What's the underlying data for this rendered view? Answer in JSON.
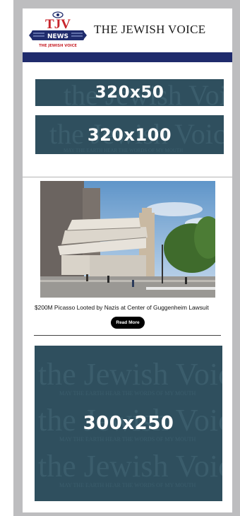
{
  "header": {
    "logo_main": "TJV",
    "logo_news": "NEWS",
    "logo_sub": "THE JEWISH VOICE",
    "title": "THE JEWISH VOICE"
  },
  "ads": {
    "leaderboard_small": "320x50",
    "leaderboard_large": "320x100",
    "medium_rectangle": "300x250",
    "watermark_name": "the Jewish Voice",
    "watermark_tagline": "MAY THE EARTH HEAR THE WORDS OF MY MOUTH"
  },
  "article": {
    "headline": "$200M Picasso Looted by Nazis at Center of Guggenheim Lawsuit",
    "button": "Read More"
  },
  "colors": {
    "brand_red": "#c8252c",
    "brand_blue": "#1f2b6c",
    "ad_background": "#2f4f5e"
  }
}
